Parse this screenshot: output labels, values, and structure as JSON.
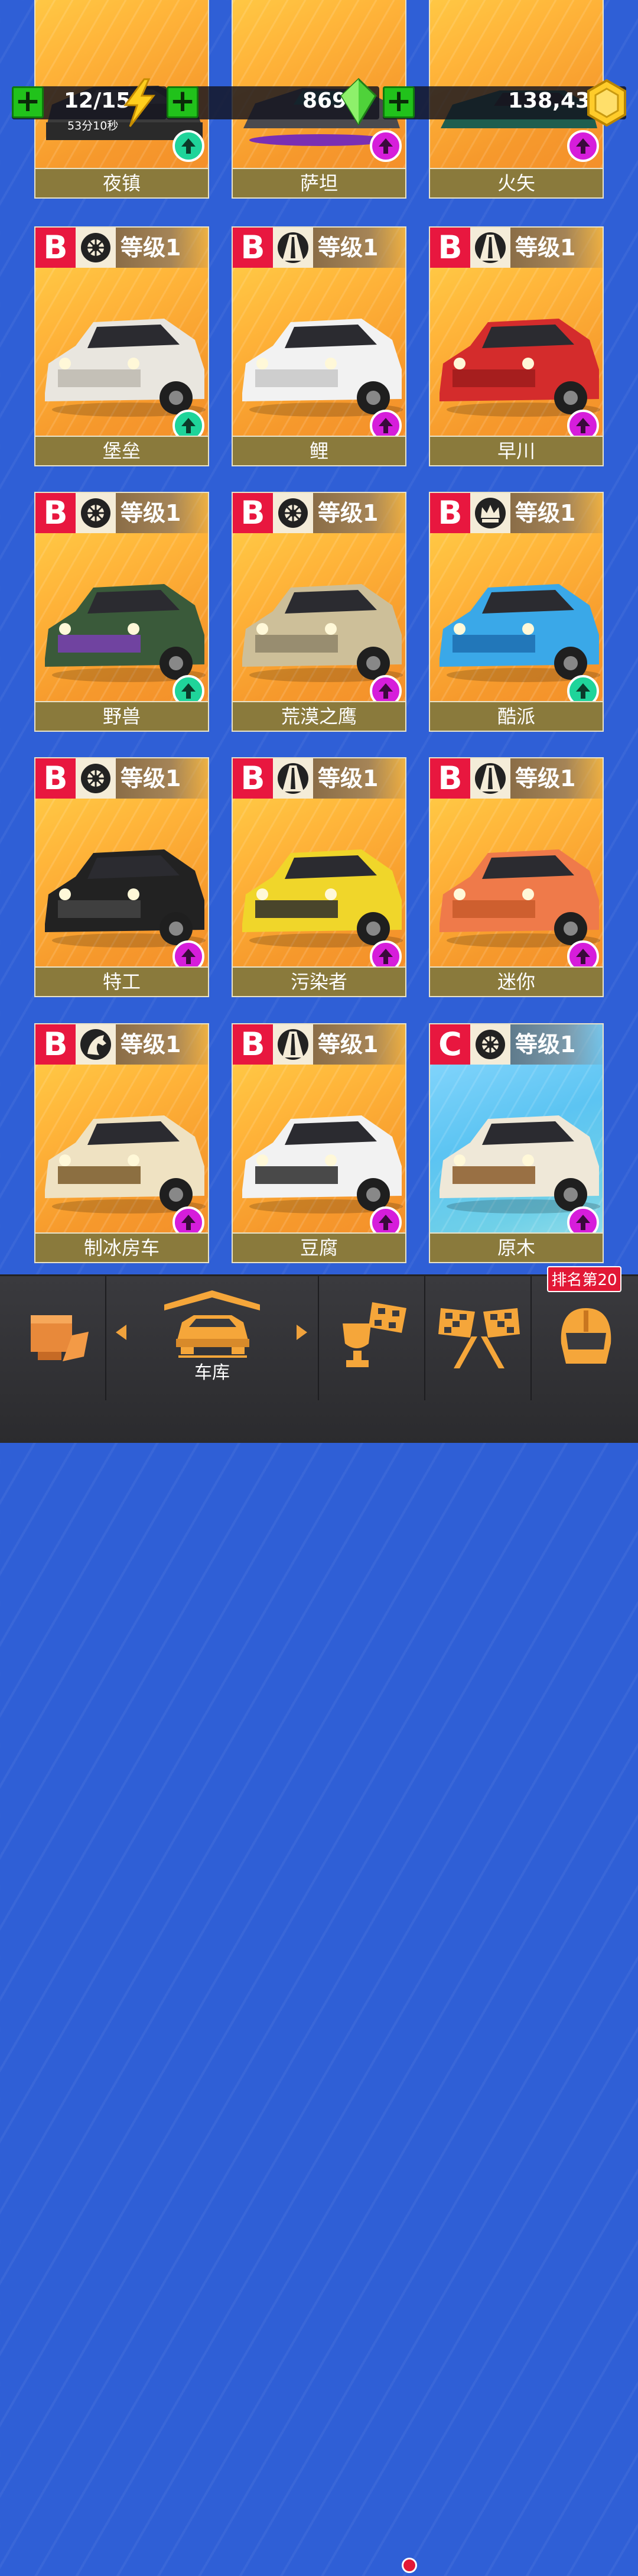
{
  "resources": {
    "energy": {
      "value": "12/15",
      "timer": "53分10秒"
    },
    "gems": {
      "value": "869"
    },
    "coins": {
      "value": "138,433"
    }
  },
  "top_row_names": [
    "夜镇",
    "萨坦",
    "火矢"
  ],
  "cards": [
    {
      "class": "B",
      "icon": "wheel-icon",
      "level": "等级1",
      "name": "堡垒",
      "upgrade": "green"
    },
    {
      "class": "B",
      "icon": "road-icon",
      "level": "等级1",
      "name": "鲤",
      "upgrade": "pink"
    },
    {
      "class": "B",
      "icon": "road-icon",
      "level": "等级1",
      "name": "早川",
      "upgrade": "pink"
    },
    {
      "class": "B",
      "icon": "wheel-icon",
      "level": "等级1",
      "name": "野兽",
      "upgrade": "green"
    },
    {
      "class": "B",
      "icon": "wheel-icon",
      "level": "等级1",
      "name": "荒漠之鹰",
      "upgrade": "pink"
    },
    {
      "class": "B",
      "icon": "crown-gauge-icon",
      "level": "等级1",
      "name": "酷派",
      "upgrade": "green"
    },
    {
      "class": "B",
      "icon": "wheel-icon",
      "level": "等级1",
      "name": "特工",
      "upgrade": "pink"
    },
    {
      "class": "B",
      "icon": "road-icon",
      "level": "等级1",
      "name": "污染者",
      "upgrade": "pink"
    },
    {
      "class": "B",
      "icon": "road-icon",
      "level": "等级1",
      "name": "迷你",
      "upgrade": "pink"
    },
    {
      "class": "B",
      "icon": "horse-icon",
      "level": "等级1",
      "name": "制冰房车",
      "upgrade": "pink"
    },
    {
      "class": "B",
      "icon": "road-icon",
      "level": "等级1",
      "name": "豆腐",
      "upgrade": "pink"
    },
    {
      "class": "C",
      "icon": "wheel-icon",
      "level": "等级1",
      "name": "原木",
      "upgrade": "pink"
    }
  ],
  "nav": {
    "garage_label": "车库",
    "rank_badge": "排名第20"
  }
}
